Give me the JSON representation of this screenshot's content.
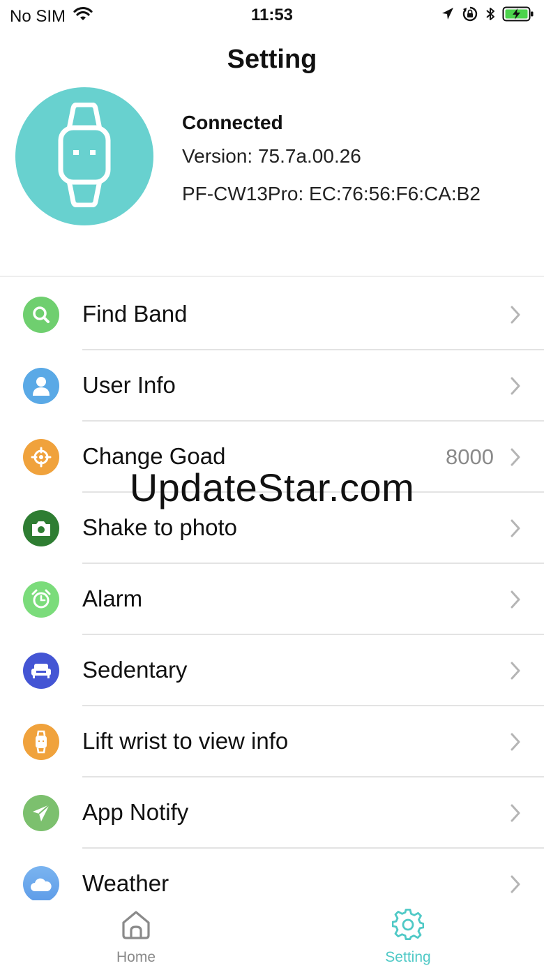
{
  "status_bar": {
    "carrier": "No SIM",
    "time": "11:53",
    "icons": [
      "wifi-icon",
      "location-icon",
      "orientation-lock-icon",
      "bluetooth-icon",
      "battery-charging-icon"
    ]
  },
  "title": "Setting",
  "device": {
    "status": "Connected",
    "version": "Version: 75.7a.00.26",
    "mac": "PF-CW13Pro: EC:76:56:F6:CA:B2",
    "avatar_icon": "watch-icon",
    "avatar_color": "#68d1cf"
  },
  "menu": [
    {
      "label": "Find Band",
      "value": "",
      "icon": "search-icon",
      "color": "#6fcf6f"
    },
    {
      "label": "User Info",
      "value": "",
      "icon": "user-icon",
      "color": "#5aa9e6"
    },
    {
      "label": "Change Goad",
      "value": "8000",
      "icon": "target-icon",
      "color": "#f0a23c"
    },
    {
      "label": "Shake to photo",
      "value": "",
      "icon": "camera-icon",
      "color": "#2e7d32"
    },
    {
      "label": "Alarm",
      "value": "",
      "icon": "alarm-clock-icon",
      "color": "#7bdc7b"
    },
    {
      "label": "Sedentary",
      "value": "",
      "icon": "sofa-icon",
      "color": "#4455d4"
    },
    {
      "label": "Lift wrist to view info",
      "value": "",
      "icon": "watch-icon",
      "color": "#f0a23c"
    },
    {
      "label": "App Notify",
      "value": "",
      "icon": "paper-plane-icon",
      "color": "#7cc06e"
    },
    {
      "label": "Weather",
      "value": "",
      "icon": "cloud-icon",
      "color": "#6fa8ee"
    }
  ],
  "watermark": "UpdateStar.com",
  "tabs": [
    {
      "label": "Home",
      "icon": "home-icon",
      "active": false
    },
    {
      "label": "Setting",
      "icon": "gear-icon",
      "active": true
    }
  ],
  "colors": {
    "accent": "#4fc9c6",
    "inactive": "#8a8a8a"
  }
}
